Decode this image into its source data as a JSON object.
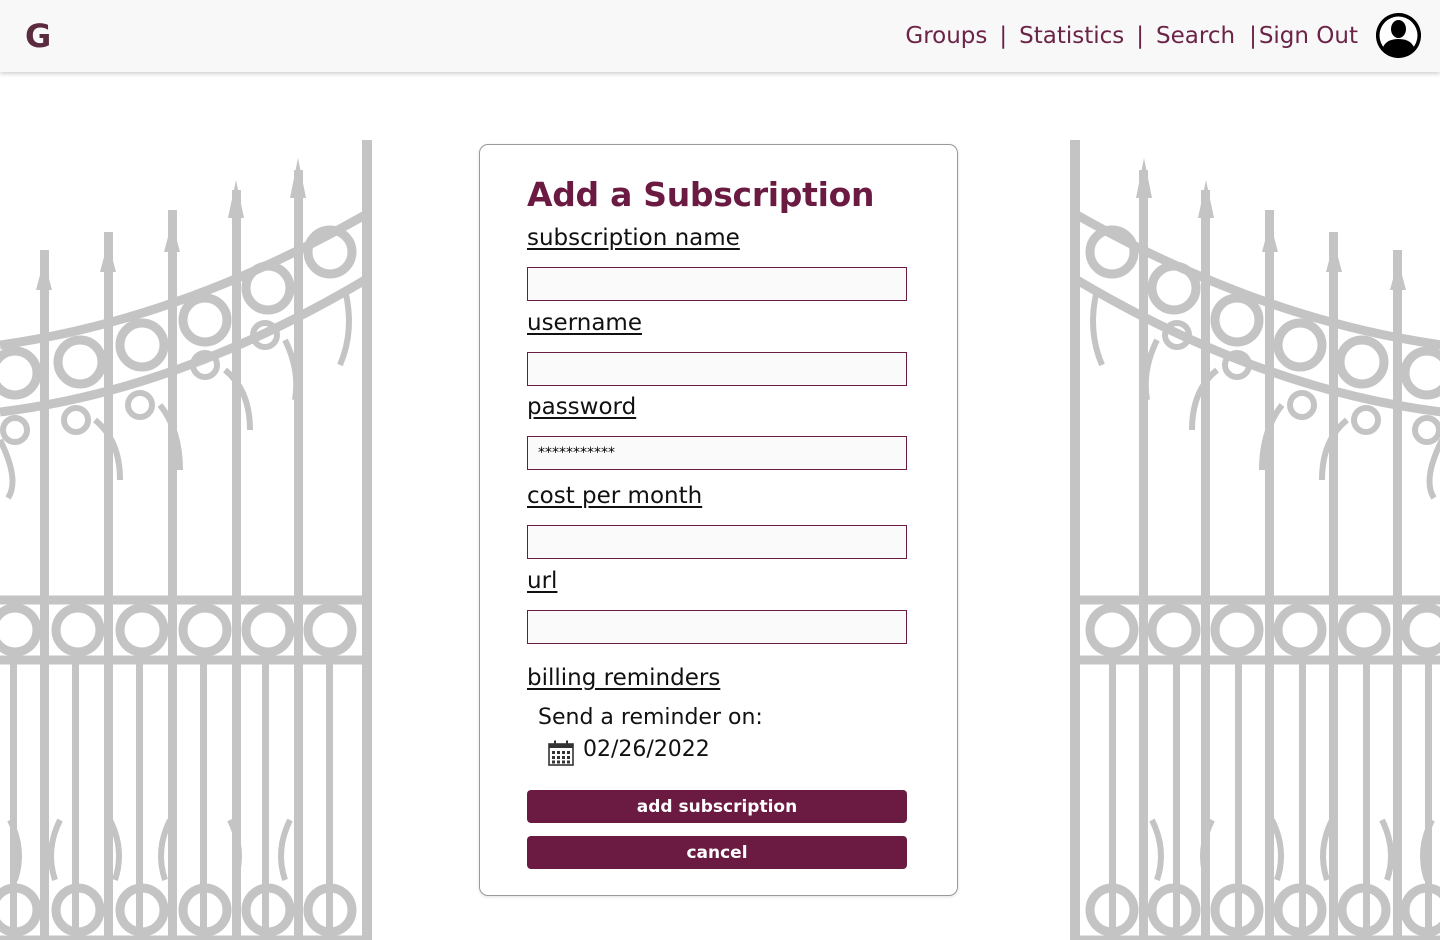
{
  "header": {
    "logo": "G",
    "nav": [
      "Groups",
      "Statistics",
      "Search",
      "Sign Out"
    ],
    "separator": "|",
    "avatar_icon": "user-avatar-icon"
  },
  "form": {
    "title": "Add a Subscription",
    "fields": [
      {
        "label": "subscription name",
        "value": ""
      },
      {
        "label": "username",
        "value": ""
      },
      {
        "label": "password",
        "value": "***********"
      },
      {
        "label": "cost per month",
        "value": ""
      },
      {
        "label": "url",
        "value": ""
      }
    ],
    "billing": {
      "label": "billing reminders",
      "reminder_text": "Send a reminder on:",
      "date": "02/26/2022",
      "icon": "calendar-icon"
    },
    "submit_label": "add subscription",
    "cancel_label": "cancel"
  },
  "colors": {
    "accent": "#6b1b42",
    "nav_text": "#6b2447",
    "gate": "#c4c4c4",
    "header_bg": "#f8f8f8"
  }
}
